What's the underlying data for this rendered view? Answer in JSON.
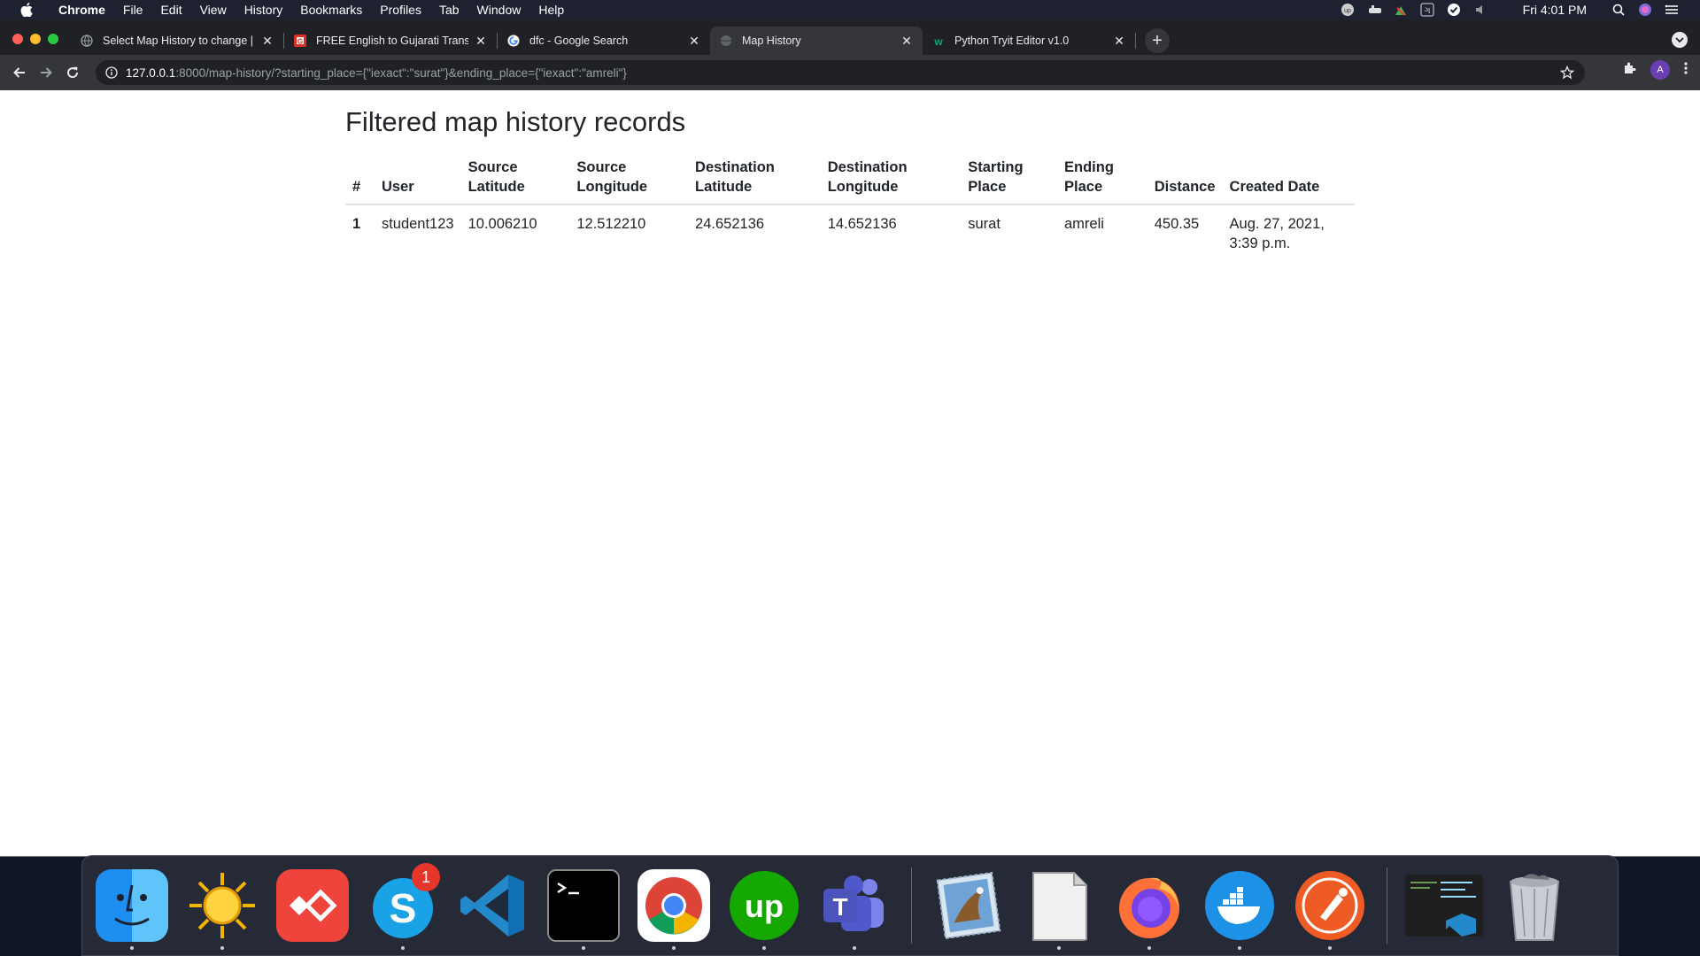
{
  "menubar": {
    "app_name": "Chrome",
    "items": [
      "File",
      "Edit",
      "View",
      "History",
      "Bookmarks",
      "Profiles",
      "Tab",
      "Window",
      "Help"
    ],
    "clock": "Fri 4:01 PM"
  },
  "browser": {
    "tabs": [
      {
        "title": "Select Map History to change | Django site admin",
        "active": false
      },
      {
        "title": "FREE English to Gujarati Translation",
        "active": false
      },
      {
        "title": "dfc - Google Search",
        "active": false
      },
      {
        "title": "Map History",
        "active": true
      },
      {
        "title": "Python Tryit Editor v1.0",
        "active": false
      }
    ],
    "url_host": "127.0.0.1",
    "url_rest": ":8000/map-history/?starting_place={\"iexact\":\"surat\"}&ending_place={\"iexact\":\"amreli\"}",
    "profile_initial": "A"
  },
  "page": {
    "title": "Filtered map history records",
    "columns": [
      "#",
      "User",
      "Source Latitude",
      "Source Longitude",
      "Destination Latitude",
      "Destination Longitude",
      "Starting Place",
      "Ending Place",
      "Distance",
      "Created Date"
    ],
    "rows": [
      [
        "1",
        "student123",
        "10.006210",
        "12.512210",
        "24.652136",
        "14.652136",
        "surat",
        "amreli",
        "450.35",
        "Aug. 27, 2021, 3:39 p.m."
      ]
    ]
  },
  "dock": {
    "skype_badge": "1",
    "apps": [
      "finder-icon",
      "sun-app-icon",
      "anydesk-icon",
      "skype-icon",
      "vscode-icon",
      "terminal-icon",
      "chrome-icon",
      "upwork-icon",
      "teams-icon",
      "mail-icon",
      "document-icon",
      "firefox-icon",
      "docker-icon",
      "postman-icon",
      "vscode-window-icon",
      "trash-icon"
    ]
  }
}
